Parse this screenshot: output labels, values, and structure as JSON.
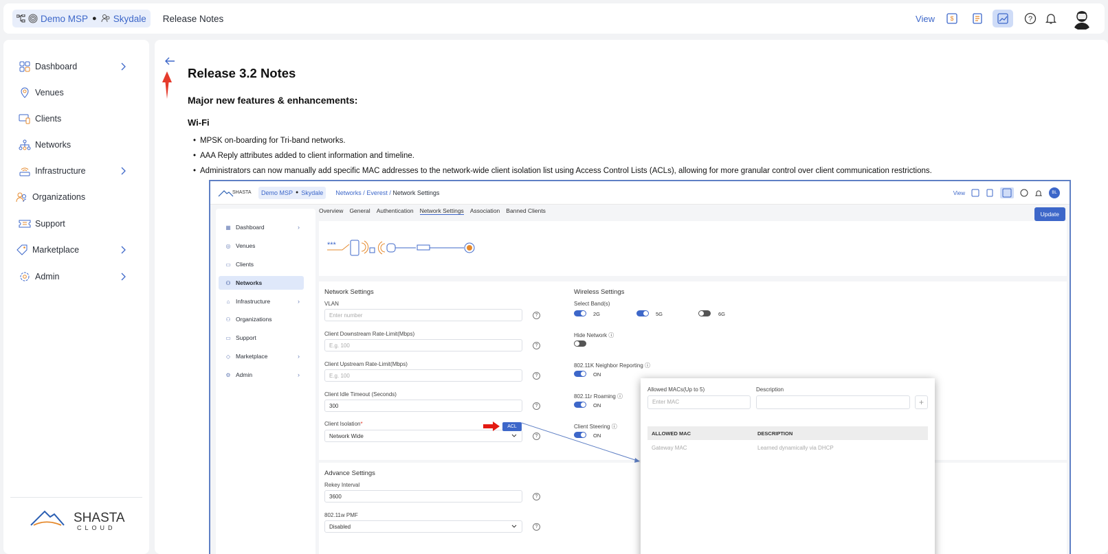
{
  "header": {
    "org_label": "Demo MSP",
    "site_label": "Skydale",
    "page_title": "Release Notes",
    "view_label": "View"
  },
  "sidebar": {
    "items": [
      {
        "label": "Dashboard",
        "icon": "dashboard-icon",
        "has_chevron": true
      },
      {
        "label": "Venues",
        "icon": "location-pin-icon",
        "has_chevron": false
      },
      {
        "label": "Clients",
        "icon": "devices-icon",
        "has_chevron": false
      },
      {
        "label": "Networks",
        "icon": "network-tree-icon",
        "has_chevron": false
      },
      {
        "label": "Infrastructure",
        "icon": "router-icon",
        "has_chevron": true
      },
      {
        "label": "Organizations",
        "icon": "users-icon",
        "has_chevron": false
      },
      {
        "label": "Support",
        "icon": "ticket-icon",
        "has_chevron": false
      },
      {
        "label": "Marketplace",
        "icon": "tag-icon",
        "has_chevron": true
      },
      {
        "label": "Admin",
        "icon": "gear-icon",
        "has_chevron": true
      }
    ],
    "logo_text": "SHASTA",
    "logo_subtext": "CLOUD"
  },
  "content": {
    "title": "Release 3.2 Notes",
    "section_heading": "Major new features & enhancements:",
    "subsection": "Wi-Fi",
    "bullets": [
      "MPSK on-boarding for Tri-band networks.",
      "AAA Reply attributes added to client information and timeline.",
      "Administrators can now manually add specific MAC addresses to the network-wide client isolation list using Access Control Lists (ACLs), allowing for more granular control over client communication restrictions."
    ]
  },
  "screenshot": {
    "logo": "SHASTA",
    "org": "Demo MSP",
    "site": "Skydale",
    "path_networks": "Networks",
    "path_everest": "Everest",
    "path_current": "Network Settings",
    "view": "View",
    "avatar": "BL",
    "tabs": [
      "Overview",
      "General",
      "Authentication",
      "Network Settings",
      "Association",
      "Banned Clients"
    ],
    "update_btn": "Update",
    "sidebar": [
      "Dashboard",
      "Venues",
      "Clients",
      "Networks",
      "Infrastructure",
      "Organizations",
      "Support",
      "Marketplace",
      "Admin"
    ],
    "network_settings": {
      "heading": "Network Settings",
      "vlan_label": "VLAN",
      "vlan_placeholder": "Enter number",
      "down_label": "Client Downstream Rate-Limit(Mbps)",
      "down_placeholder": "E.g. 100",
      "up_label": "Client Upstream Rate-Limit(Mbps)",
      "up_placeholder": "E.g. 100",
      "idle_label": "Client Idle Timeout (Seconds)",
      "idle_value": "300",
      "isolation_label": "Client Isolation",
      "isolation_value": "Network Wide",
      "acl_btn": "ACL"
    },
    "wireless": {
      "heading": "Wireless Settings",
      "bands_label": "Select Band(s)",
      "band_2g": "2G",
      "band_5g": "5G",
      "band_6g": "6G",
      "hide_label": "Hide Network",
      "k_label": "802.11K Neighbor Reporting",
      "r_label": "802.11r Roaming",
      "steer_label": "Client Steering",
      "on": "ON"
    },
    "advanced": {
      "heading": "Advance Settings",
      "rekey_label": "Rekey Interval",
      "rekey_value": "3600",
      "pmf_label": "802.11w PMF",
      "pmf_value": "Disabled"
    },
    "acl_popup": {
      "mac_label": "Allowed MACs(Up to 5)",
      "mac_placeholder": "Enter MAC",
      "desc_label": "Description",
      "col_mac": "ALLOWED MAC",
      "col_desc": "DESCRIPTION",
      "row_mac": "Gateway MAC",
      "row_desc": "Learned dynamically via DHCP"
    }
  },
  "colors": {
    "accent": "#3d67c9",
    "annotation_red": "#e53b2c"
  }
}
